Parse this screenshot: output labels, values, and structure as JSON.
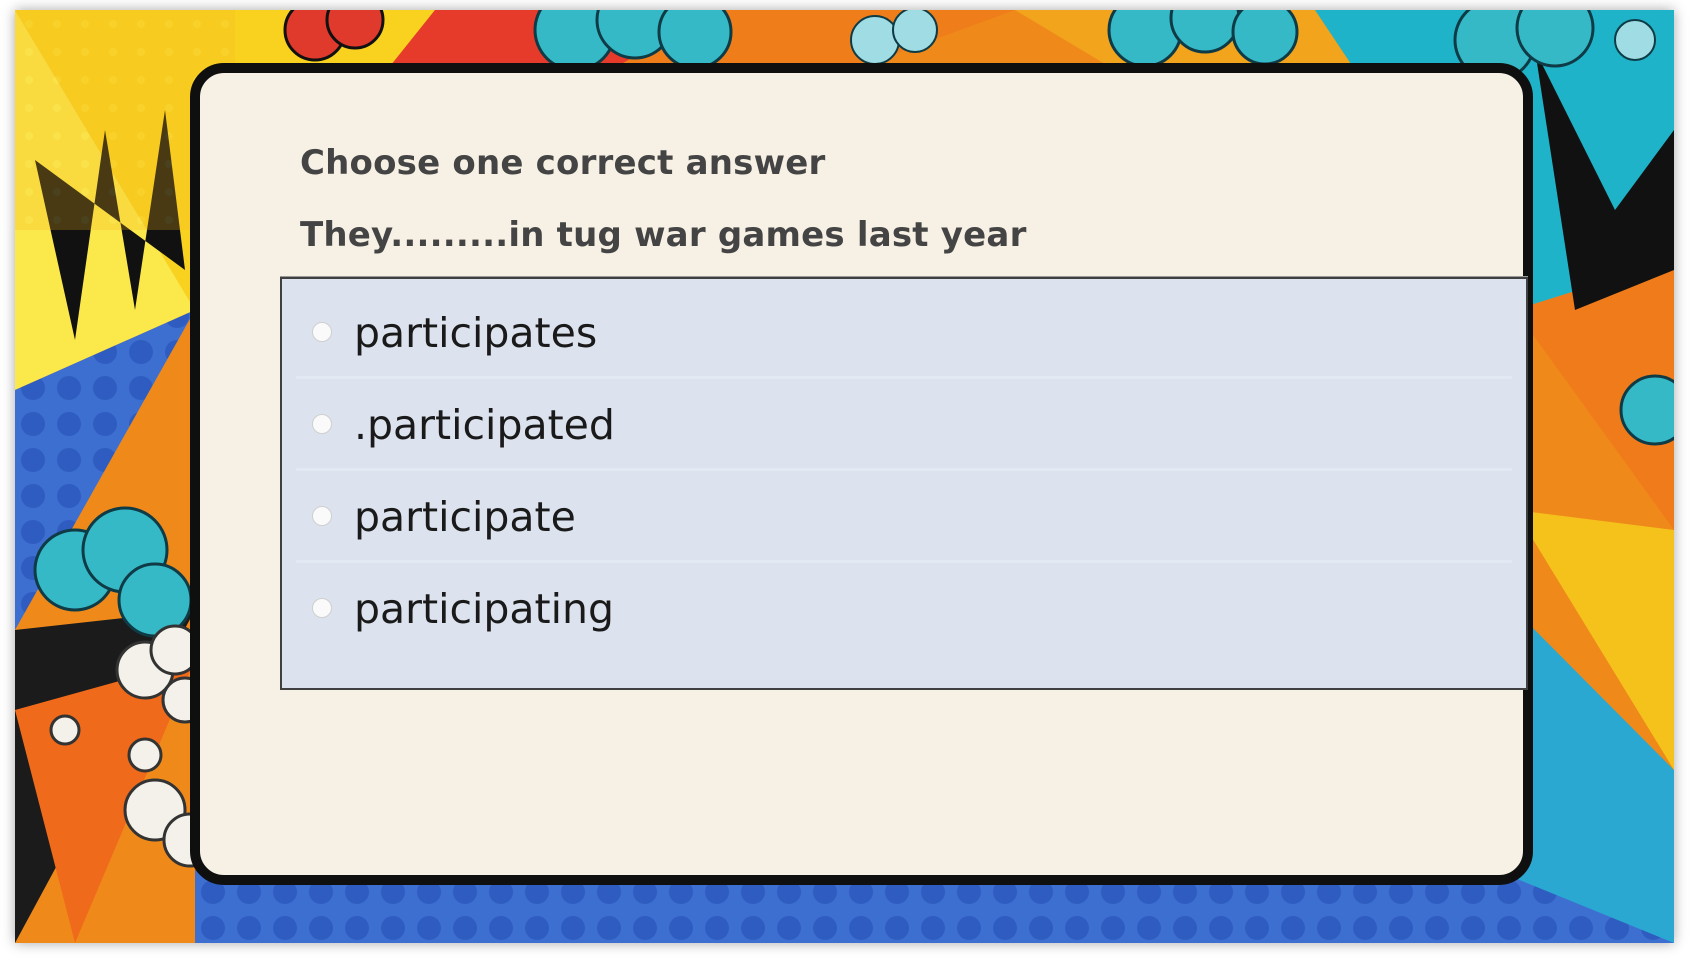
{
  "quiz": {
    "instruction": "Choose one correct answer",
    "question": "They.........in tug war games last year",
    "options": [
      {
        "label": "participates"
      },
      {
        "label": ".participated"
      },
      {
        "label": "participate"
      },
      {
        "label": "participating"
      }
    ]
  },
  "colors": {
    "card_background": "#f6f0e5",
    "options_background": "#dce3ee",
    "card_border": "#0f0f0f",
    "text": "#444444"
  }
}
